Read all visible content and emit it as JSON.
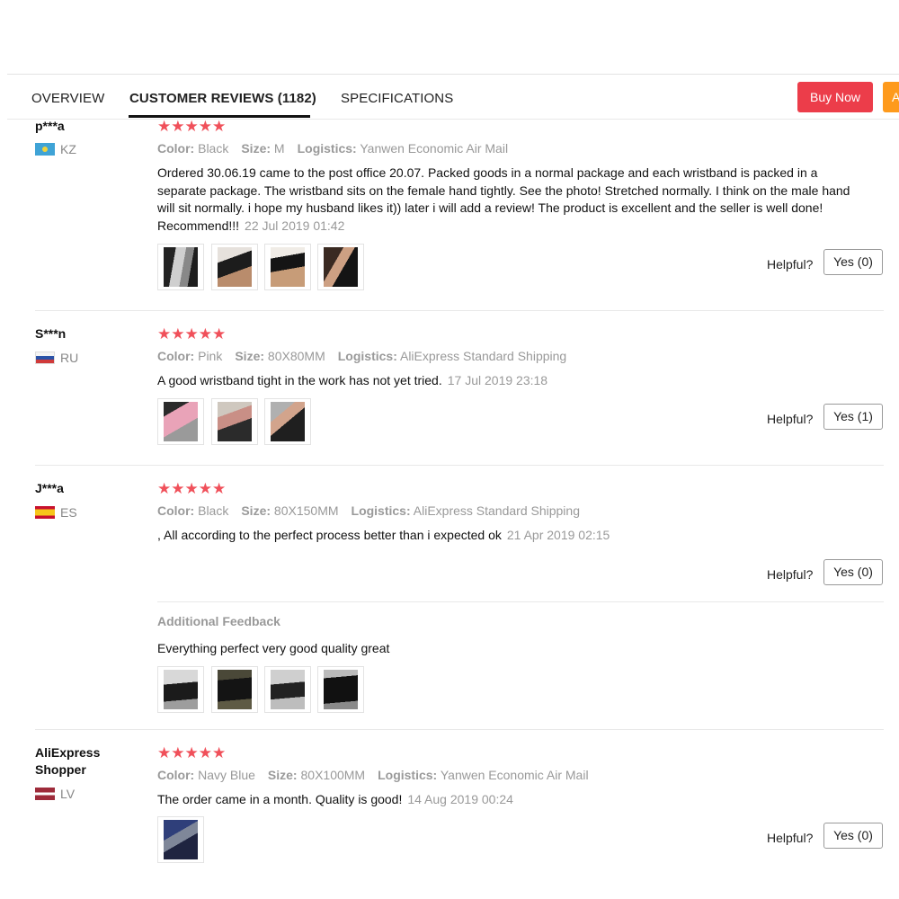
{
  "tabs": [
    {
      "label": "OVERVIEW"
    },
    {
      "label": "CUSTOMER REVIEWS (1182)"
    },
    {
      "label": "SPECIFICATIONS"
    }
  ],
  "actions": {
    "buy_now": "Buy Now",
    "add_to_cart": "A"
  },
  "colors": {
    "accent_buy": "#ec3d4a",
    "accent_cart": "#fe9a1c",
    "star": "#f0505a"
  },
  "reviews": [
    {
      "user": "p***a",
      "country": "KZ",
      "stars": "★★★★★",
      "color_label": "Color:",
      "color": "Black",
      "size_label": "Size:",
      "size": "M",
      "logistics_label": "Logistics:",
      "logistics": "Yanwen Economic Air Mail",
      "text": "Ordered 30.06.19 came to the post office 20.07. Packed goods in a normal package and each wristband is packed in a separate package. The wristband sits on the female hand tightly. See the photo! Stretched normally. I think on the male hand will sit normally. i hope my husband likes it)) later i will add a review! The product is excellent and the seller is well done! Recommend!!!",
      "date": "22 Jul 2019 01:42",
      "helpful": "Helpful?",
      "yes": "Yes (0)"
    },
    {
      "user": "S***n",
      "country": "RU",
      "stars": "★★★★★",
      "color_label": "Color:",
      "color": "Pink",
      "size_label": "Size:",
      "size": "80X80MM",
      "logistics_label": "Logistics:",
      "logistics": "AliExpress Standard Shipping",
      "text": "A good wristband tight in the work has not yet tried.",
      "date": "17 Jul 2019 23:18",
      "helpful": "Helpful?",
      "yes": "Yes (1)"
    },
    {
      "user": "J***a",
      "country": "ES",
      "stars": "★★★★★",
      "color_label": "Color:",
      "color": "Black",
      "size_label": "Size:",
      "size": "80X150MM",
      "logistics_label": "Logistics:",
      "logistics": "AliExpress Standard Shipping",
      "text": ", All according to the perfect process better than i expected ok",
      "date": "21 Apr 2019 02:15",
      "helpful": "Helpful?",
      "yes": "Yes (0)",
      "additional_title": "Additional Feedback",
      "additional_text": "Everything perfect very good quality great"
    },
    {
      "user": "AliExpress Shopper",
      "country": "LV",
      "stars": "★★★★★",
      "color_label": "Color:",
      "color": "Navy Blue",
      "size_label": "Size:",
      "size": "80X100MM",
      "logistics_label": "Logistics:",
      "logistics": "Yanwen Economic Air Mail",
      "text": "The order came in a month. Quality is good!",
      "date": "14 Aug 2019 00:24",
      "helpful": "Helpful?",
      "yes": "Yes (0)"
    }
  ]
}
